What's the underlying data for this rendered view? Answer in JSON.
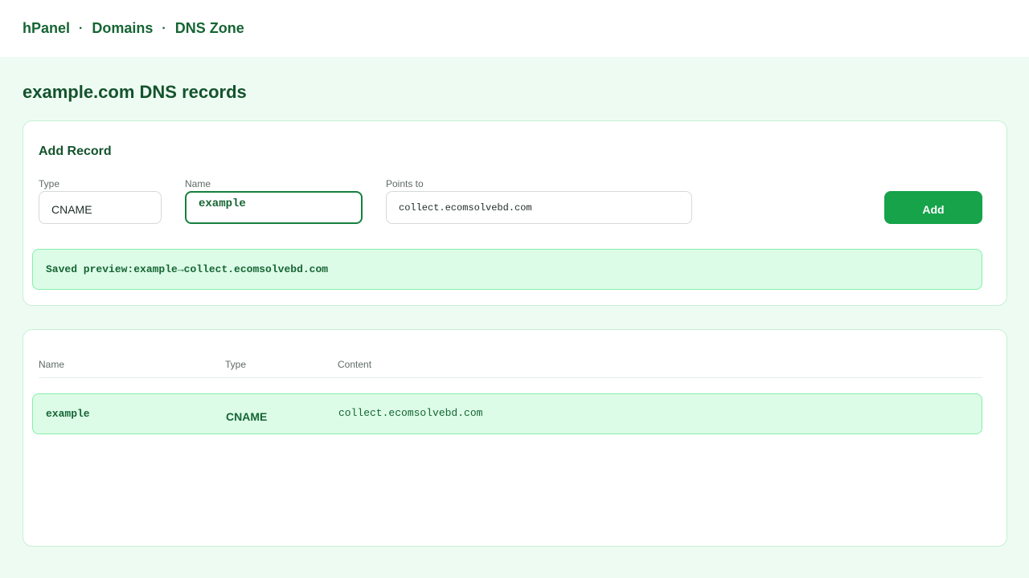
{
  "breadcrumb": {
    "items": [
      "hPanel",
      "Domains",
      "DNS Zone"
    ],
    "separator": "·"
  },
  "page": {
    "title": "example.com DNS records"
  },
  "add_record": {
    "title": "Add Record",
    "type": {
      "label": "Type",
      "value": "CNAME"
    },
    "name": {
      "label": "Name",
      "value": "example"
    },
    "points_to": {
      "label": "Points to",
      "value": "collect.ecomsolvebd.com"
    },
    "add_button": "Add",
    "preview": {
      "label": "Saved preview:",
      "name": "example",
      "arrow": "→",
      "target": "collect.ecomsolvebd.com"
    }
  },
  "records_table": {
    "columns": [
      "Name",
      "Type",
      "Content"
    ],
    "rows": [
      {
        "name": "example",
        "type": "CNAME",
        "content": "collect.ecomsolvebd.com"
      }
    ]
  },
  "colors": {
    "accent": "#16a34a",
    "text_dark": "#14532d",
    "background": "#eefbf2",
    "highlight": "#dcfce7"
  }
}
